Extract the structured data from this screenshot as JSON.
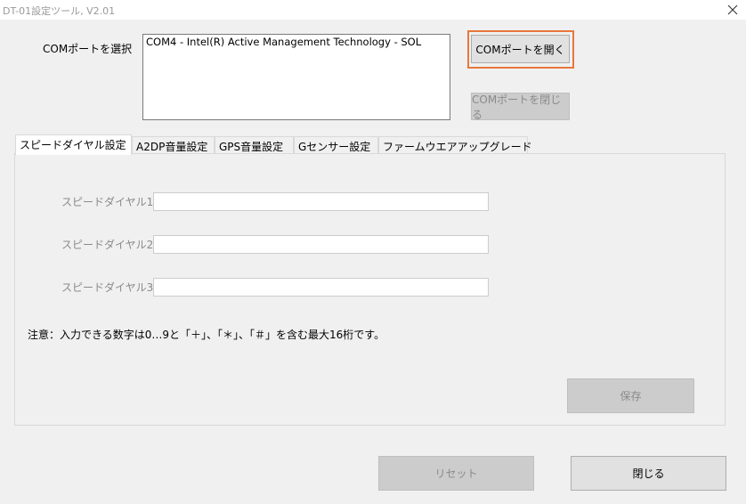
{
  "window": {
    "title": "DT-01設定ツール, V2.01"
  },
  "com": {
    "select_label": "COMポートを選択",
    "ports": [
      "COM4  -  Intel(R) Active Management Technology - SOL"
    ],
    "open_button": "COMポートを開く",
    "close_button": "COMポートを閉じる"
  },
  "tabs": [
    {
      "label": "スピードダイヤル設定",
      "active": true
    },
    {
      "label": "A2DP音量設定",
      "active": false
    },
    {
      "label": "GPS音量設定",
      "active": false
    },
    {
      "label": "Gセンサー設定",
      "active": false
    },
    {
      "label": "ファームウエアアップグレード",
      "active": false
    }
  ],
  "speed_dial": {
    "fields": [
      {
        "label": "スピードダイヤル1",
        "value": ""
      },
      {
        "label": "スピードダイヤル2",
        "value": ""
      },
      {
        "label": "スピードダイヤル3",
        "value": ""
      }
    ],
    "note": "注意：入力できる数字は0…9と「＋」、「＊」、「＃」を含む最大16桁です。",
    "save_button": "保存"
  },
  "footer": {
    "reset_button": "リセット",
    "close_button": "閉じる"
  },
  "colors": {
    "focus_border": "#e8773c",
    "disabled_text": "#8a8a8a"
  },
  "icons": {
    "close": "close-icon"
  }
}
